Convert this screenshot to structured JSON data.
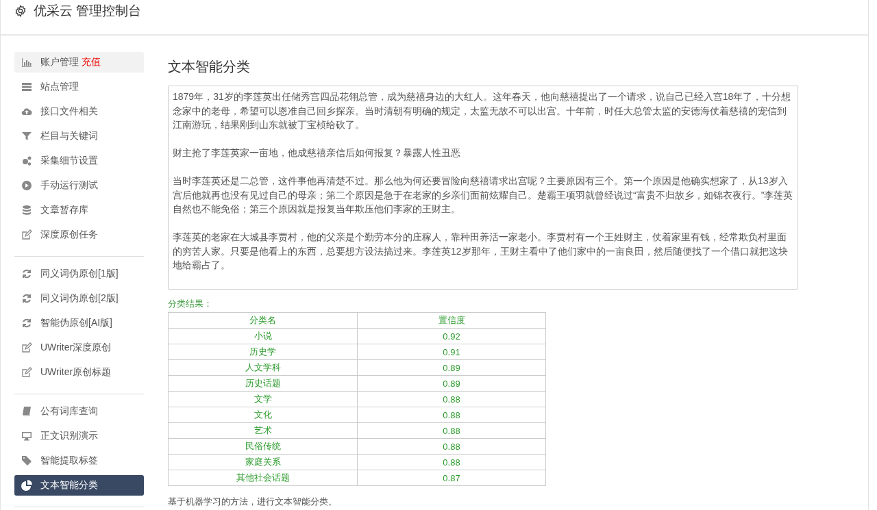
{
  "header": {
    "title": "优采云 管理控制台"
  },
  "sidebar": {
    "groups": [
      {
        "items": [
          {
            "label": "账户管理",
            "badge": "充值",
            "highlighted": true,
            "selected": false
          },
          {
            "label": "站点管理",
            "highlighted": false,
            "selected": false
          },
          {
            "label": "接口文件相关",
            "highlighted": false,
            "selected": false
          },
          {
            "label": "栏目与关键词",
            "highlighted": false,
            "selected": false
          },
          {
            "label": "采集细节设置",
            "highlighted": false,
            "selected": false
          },
          {
            "label": "手动运行测试",
            "highlighted": false,
            "selected": false
          },
          {
            "label": "文章暂存库",
            "highlighted": false,
            "selected": false
          },
          {
            "label": "深度原创任务",
            "highlighted": false,
            "selected": false
          }
        ]
      },
      {
        "items": [
          {
            "label": "同义词伪原创[1版]",
            "highlighted": false,
            "selected": false
          },
          {
            "label": "同义词伪原创[2版]",
            "highlighted": false,
            "selected": false
          },
          {
            "label": "智能伪原创[AI版]",
            "highlighted": false,
            "selected": false
          },
          {
            "label": "UWriter深度原创",
            "highlighted": false,
            "selected": false
          },
          {
            "label": "UWriter原创标题",
            "highlighted": false,
            "selected": false
          }
        ]
      },
      {
        "items": [
          {
            "label": "公有词库查询",
            "highlighted": false,
            "selected": false
          },
          {
            "label": "正文识别演示",
            "highlighted": false,
            "selected": false
          },
          {
            "label": "智能提取标签",
            "highlighted": false,
            "selected": false
          },
          {
            "label": "文本智能分类",
            "highlighted": false,
            "selected": true
          }
        ]
      }
    ]
  },
  "main": {
    "title": "文本智能分类",
    "text_input": {
      "paragraphs": [
        "1879年，31岁的李莲英出任储秀宫四品花翎总管，成为慈禧身边的大红人。这年春天，他向慈禧提出了一个请求，说自己已经入宫18年了，十分想念家中的老母，希望可以恩准自己回乡探亲。当时清朝有明确的规定，太监无故不可以出宫。十年前，时任大总管太监的安德海仗着慈禧的宠信到江南游玩，结果刚到山东就被丁宝桢给砍了。",
        "财主抢了李莲英家一亩地，他成慈禧亲信后如何报复？暴露人性丑恶",
        "当时李莲英还是二总管，这件事他再清楚不过。那么他为何还要冒险向慈禧请求出宫呢？主要原因有三个。第一个原因是他确实想家了，从13岁入宫后他就再也没有见过自己的母亲；第二个原因是急于在老家的乡亲们面前炫耀自己。楚霸王项羽就曾经说过“富贵不归故乡，如锦衣夜行。”李莲英自然也不能免俗；第三个原因就是报复当年欺压他们李家的王财主。",
        "李莲英的老家在大城县李贾村，他的父亲是个勤劳本分的庄稼人，靠种田养活一家老小。李贾村有一个王姓财主，仗着家里有钱，经常欺负村里面的穷苦人家。只要是他看上的东西，总要想方设法搞过来。李莲英12岁那年，王财主看中了他们家中的一亩良田，然后随便找了一个借口就把这块地给霸占了。"
      ]
    },
    "result_label": "分类结果：",
    "table": {
      "columns": [
        "分类名",
        "置信度"
      ],
      "rows": [
        [
          "小说",
          "0.92"
        ],
        [
          "历史学",
          "0.91"
        ],
        [
          "人文学科",
          "0.89"
        ],
        [
          "历史话题",
          "0.89"
        ],
        [
          "文学",
          "0.88"
        ],
        [
          "文化",
          "0.88"
        ],
        [
          "艺术",
          "0.88"
        ],
        [
          "民俗传统",
          "0.88"
        ],
        [
          "家庭关系",
          "0.88"
        ],
        [
          "其他社会话题",
          "0.87"
        ]
      ]
    },
    "note": "基于机器学习的方法，进行文本智能分类。"
  }
}
